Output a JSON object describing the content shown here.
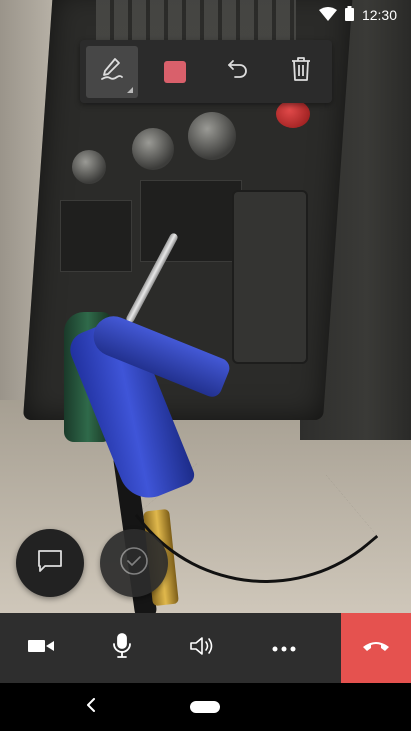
{
  "status_bar": {
    "time": "12:30",
    "wifi_icon": "wifi-icon",
    "battery_icon": "battery-icon"
  },
  "annotation_toolbar": {
    "tools": [
      {
        "name": "pen-tool",
        "icon": "pen-icon",
        "active": true
      },
      {
        "name": "color-picker",
        "icon": "color-swatch",
        "color": "#d9606b",
        "active": false
      },
      {
        "name": "undo",
        "icon": "undo-icon",
        "active": false
      },
      {
        "name": "delete",
        "icon": "trash-icon",
        "active": false
      }
    ]
  },
  "floating_actions": [
    {
      "name": "chat",
      "icon": "chat-bubble-icon"
    },
    {
      "name": "done",
      "icon": "checkmark-icon"
    }
  ],
  "call_controls": [
    {
      "name": "video",
      "icon": "video-camera-icon"
    },
    {
      "name": "microphone",
      "icon": "microphone-icon"
    },
    {
      "name": "speaker",
      "icon": "speaker-icon"
    },
    {
      "name": "more",
      "icon": "more-dots-icon"
    },
    {
      "name": "end-call",
      "icon": "hang-up-icon",
      "color": "#e5524f"
    }
  ],
  "nav_bar": {
    "back_icon": "back-chevron-icon",
    "home_icon": "home-pill-icon"
  },
  "colors": {
    "toolbar_bg": "#2b2b2b",
    "call_bar_bg": "#2e2e2e",
    "end_call": "#e5524f",
    "annotation_color": "#d9606b"
  }
}
